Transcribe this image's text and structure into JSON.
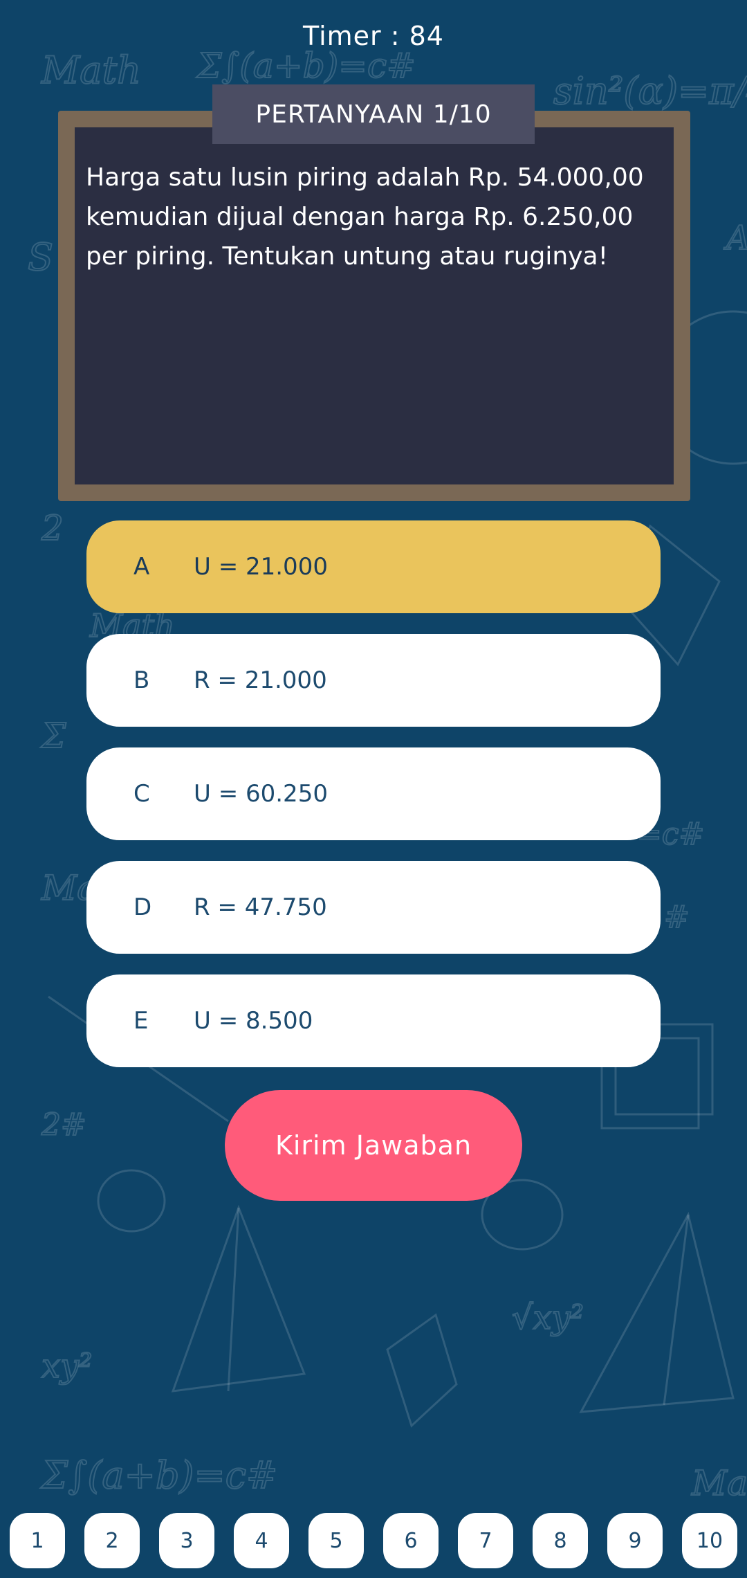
{
  "header": {
    "timer_text": "Timer : 84"
  },
  "question": {
    "banner_label": "PERTANYAAN 1/10",
    "text": "Harga satu lusin piring adalah Rp. 54.000,00 kemudian dijual dengan harga Rp. 6.250,00 per piring. Tentukan untung atau ruginya!"
  },
  "options": [
    {
      "letter": "A",
      "text": "U = 21.000",
      "selected": true
    },
    {
      "letter": "B",
      "text": "R = 21.000",
      "selected": false
    },
    {
      "letter": "C",
      "text": "U = 60.250",
      "selected": false
    },
    {
      "letter": "D",
      "text": "R = 47.750",
      "selected": false
    },
    {
      "letter": "E",
      "text": "U = 8.500",
      "selected": false
    }
  ],
  "submit": {
    "label": "Kirim Jawaban"
  },
  "navigation": {
    "pages": [
      "1",
      "2",
      "3",
      "4",
      "5",
      "6",
      "7",
      "8",
      "9",
      "10"
    ]
  },
  "colors": {
    "background": "#0e4468",
    "board": "#2b2e42",
    "board_frame": "#7a6855",
    "banner": "#4b4d63",
    "selected_option": "#eac45c",
    "submit_button": "#ff5b7a"
  }
}
